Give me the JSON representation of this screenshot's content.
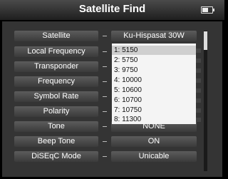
{
  "header": {
    "title": "Satellite Find",
    "battery_icon": "battery-icon"
  },
  "rows": [
    {
      "label": "Satellite",
      "value": "Ku-Hispasat 30W"
    },
    {
      "label": "Local Frequency",
      "value": ""
    },
    {
      "label": "Transponder",
      "value": ""
    },
    {
      "label": "Frequency",
      "value": ""
    },
    {
      "label": "Symbol Rate",
      "value": ""
    },
    {
      "label": "Polarity",
      "value": ""
    },
    {
      "label": "Tone",
      "value": "NONE"
    },
    {
      "label": "Beep Tone",
      "value": "ON"
    },
    {
      "label": "DiSEqC Mode",
      "value": "Unicable"
    }
  ],
  "dropdown": {
    "selected": "1: 5150",
    "options": [
      "1: 5150",
      "2: 5750",
      "3: 9750",
      "4: 10000",
      "5: 10600",
      "6: 10700",
      "7: 10750",
      "8: 11300"
    ]
  }
}
